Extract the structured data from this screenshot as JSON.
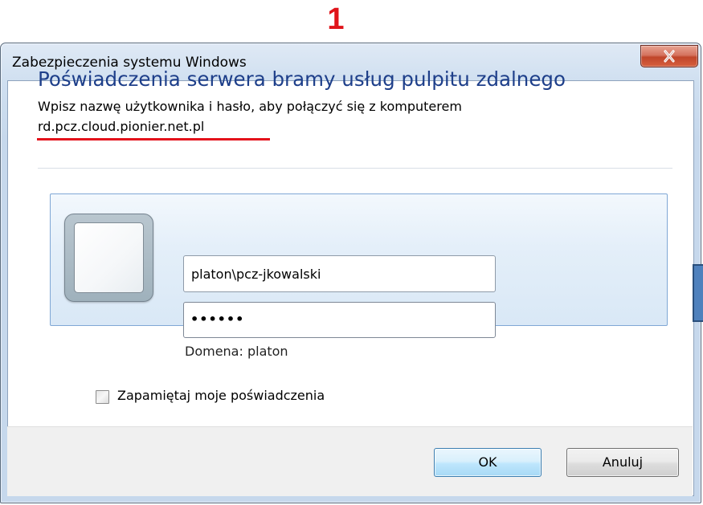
{
  "annotation": {
    "step_number": "1",
    "color": "#e0141a"
  },
  "window": {
    "title": "Zabezpieczenia systemu Windows",
    "close_icon": "close-icon"
  },
  "dialog": {
    "heading": "Poświadczenia serwera bramy usług pulpitu zdalnego",
    "instruction": "Wpisz nazwę użytkownika i hasło, aby połączyć się z komputerem",
    "server": "rd.pcz.cloud.pionier.net.pl",
    "heading_color": "#1e3f8a"
  },
  "credentials": {
    "user_tile_icon": "user-tile-icon",
    "username_value": "platon\\pcz-jkowalski",
    "password_mask": "••••••",
    "domain_label": "Domena: platon"
  },
  "remember": {
    "label": "Zapamiętaj moje poświadczenia",
    "checked": false
  },
  "buttons": {
    "ok_label": "OK",
    "cancel_label": "Anuluj"
  }
}
